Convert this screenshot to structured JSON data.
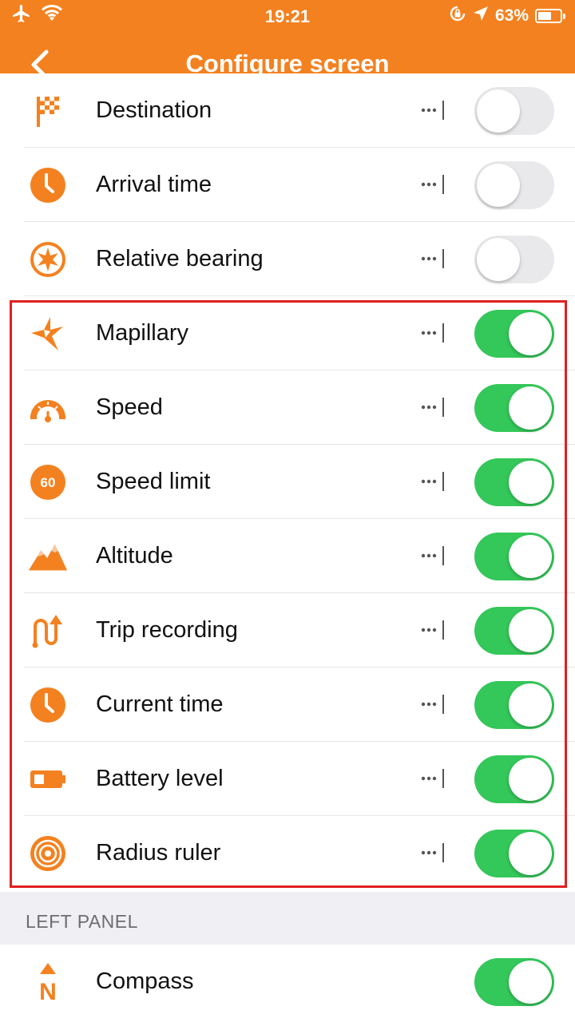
{
  "status_bar": {
    "time": "19:21",
    "battery_percent": "63%",
    "battery_level": 0.63
  },
  "header": {
    "title": "Configure screen"
  },
  "colors": {
    "accent": "#F4811F",
    "toggle_on": "#34C759",
    "toggle_off": "#E9E9EB",
    "highlight_border": "#E02020"
  },
  "widgets": [
    {
      "label": "Destination",
      "icon": "checkered-flag-icon",
      "enabled": false
    },
    {
      "label": "Arrival time",
      "icon": "clock-icon",
      "enabled": false
    },
    {
      "label": "Relative bearing",
      "icon": "compass-star-icon",
      "enabled": false
    },
    {
      "label": "Mapillary",
      "icon": "mapillary-icon",
      "enabled": true
    },
    {
      "label": "Speed",
      "icon": "speedometer-icon",
      "enabled": true
    },
    {
      "label": "Speed limit",
      "icon": "speed-limit-icon",
      "icon_text": "60",
      "enabled": true
    },
    {
      "label": "Altitude",
      "icon": "mountain-icon",
      "enabled": true
    },
    {
      "label": "Trip recording",
      "icon": "trip-recording-icon",
      "enabled": true
    },
    {
      "label": "Current time",
      "icon": "clock-icon",
      "enabled": true
    },
    {
      "label": "Battery level",
      "icon": "battery-icon",
      "enabled": true
    },
    {
      "label": "Radius ruler",
      "icon": "radius-ruler-icon",
      "enabled": true
    }
  ],
  "left_panel": {
    "section_title": "LEFT PANEL",
    "items": [
      {
        "label": "Compass",
        "icon": "compass-n-icon",
        "icon_text": "N",
        "enabled": true
      }
    ]
  }
}
